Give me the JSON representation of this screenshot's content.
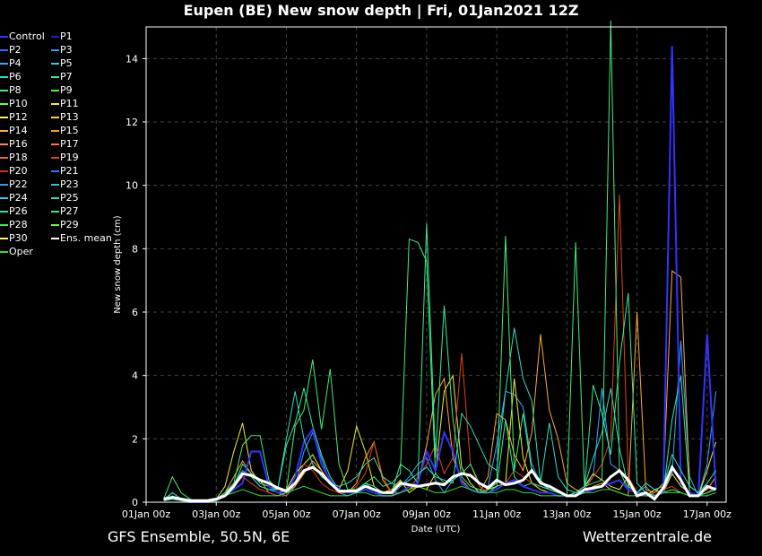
{
  "title": "Eupen  (BE)  New snow depth | Fri, 01Jan2021 12Z",
  "footer": {
    "left": "GFS Ensemble, 50.5N, 6E",
    "right": "Wetterzentrale.de"
  },
  "chart_data": {
    "type": "line",
    "xlabel": "Date (UTC)",
    "ylabel": "New snow depth (cm)",
    "ylim": [
      0,
      15
    ],
    "yticks": [
      0,
      2,
      4,
      6,
      8,
      10,
      12,
      14
    ],
    "xticks": [
      "01Jan 00z",
      "03Jan 00z",
      "05Jan 00z",
      "07Jan 00z",
      "09Jan 00z",
      "11Jan 00z",
      "13Jan 00z",
      "15Jan 00z",
      "17Jan 00z"
    ],
    "x_step_hours": 6,
    "x_start_hours": 12,
    "grid": true,
    "legend": [
      {
        "name": "Control",
        "color": "#3333ff"
      },
      {
        "name": "P1",
        "color": "#2222cc"
      },
      {
        "name": "P2",
        "color": "#3366ff"
      },
      {
        "name": "P3",
        "color": "#3399ff"
      },
      {
        "name": "P4",
        "color": "#33aaff"
      },
      {
        "name": "P5",
        "color": "#33ccdd"
      },
      {
        "name": "P6",
        "color": "#33ddcc"
      },
      {
        "name": "P7",
        "color": "#33ee99"
      },
      {
        "name": "P8",
        "color": "#44ee77"
      },
      {
        "name": "P9",
        "color": "#55ee44"
      },
      {
        "name": "P10",
        "color": "#66ff33"
      },
      {
        "name": "P11",
        "color": "#eeee33"
      },
      {
        "name": "P12",
        "color": "#ffee66"
      },
      {
        "name": "P13",
        "color": "#ffcc55"
      },
      {
        "name": "P14",
        "color": "#ffaa33"
      },
      {
        "name": "P15",
        "color": "#ff9922"
      },
      {
        "name": "P16",
        "color": "#ff8844"
      },
      {
        "name": "P17",
        "color": "#ff7733"
      },
      {
        "name": "P18",
        "color": "#ee6622"
      },
      {
        "name": "P19",
        "color": "#dd4411"
      },
      {
        "name": "P20",
        "color": "#cc3322"
      },
      {
        "name": "P21",
        "color": "#3377ee"
      },
      {
        "name": "P22",
        "color": "#3399ee"
      },
      {
        "name": "P23",
        "color": "#33bbee"
      },
      {
        "name": "P24",
        "color": "#33ccee"
      },
      {
        "name": "P25",
        "color": "#33ddbb"
      },
      {
        "name": "P26",
        "color": "#33dd99"
      },
      {
        "name": "P27",
        "color": "#33ee66"
      },
      {
        "name": "P28",
        "color": "#44ee55"
      },
      {
        "name": "P29",
        "color": "#66ff33"
      },
      {
        "name": "P30",
        "color": "#ffff55"
      },
      {
        "name": "Ens. mean",
        "color": "#ffffff"
      },
      {
        "name": "Oper",
        "color": "#33dd33"
      }
    ],
    "series": [
      {
        "name": "Ens. mean",
        "color": "#ffffff",
        "values": [
          0.1,
          0.15,
          0.1,
          0.05,
          0.05,
          0.05,
          0.1,
          0.2,
          0.5,
          0.9,
          0.85,
          0.7,
          0.6,
          0.45,
          0.35,
          0.6,
          1.0,
          1.1,
          0.9,
          0.6,
          0.35,
          0.35,
          0.35,
          0.5,
          0.4,
          0.3,
          0.3,
          0.6,
          0.55,
          0.5,
          0.55,
          0.6,
          0.55,
          0.8,
          0.9,
          0.85,
          0.6,
          0.45,
          0.7,
          0.55,
          0.6,
          0.7,
          1.0,
          0.6,
          0.5,
          0.35,
          0.2,
          0.2,
          0.4,
          0.45,
          0.5,
          0.8,
          1.0,
          0.7,
          0.2,
          0.3,
          0.1,
          0.45,
          1.1,
          0.7,
          0.2,
          0.2,
          0.5,
          0.4
        ]
      },
      {
        "name": "P22",
        "color": "#33aaff",
        "values": [
          0.1,
          0.3,
          0.1,
          0,
          0,
          0,
          0.1,
          0.2,
          0.6,
          1.0,
          0.8,
          0.5,
          0.4,
          0.3,
          0.2,
          0.5,
          1.6,
          2.2,
          1.4,
          0.6,
          0.3,
          0.2,
          0.3,
          0.6,
          0.4,
          0.2,
          0.2,
          0.5,
          0.8,
          1.2,
          1.4,
          0.7,
          0.3,
          0.7,
          0.9,
          0.8,
          0.6,
          0.5,
          1.8,
          3.5,
          3.4,
          3.0,
          1.2,
          0.6,
          0.4,
          0.3,
          0.2,
          0.3,
          0.5,
          0.8,
          3.6,
          1.2,
          1.0,
          0.7,
          0.3,
          0.5,
          0.2,
          0.4,
          0.9,
          5.1,
          0.8,
          0.2,
          1.2,
          3.5
        ]
      },
      {
        "name": "P11",
        "color": "#eeee33",
        "values": [
          0.05,
          0.1,
          0.05,
          0,
          0,
          0,
          0.1,
          0.5,
          1.6,
          2.5,
          1.0,
          0.6,
          0.5,
          0.3,
          0.4,
          0.9,
          1.2,
          1.5,
          1.0,
          0.6,
          0.4,
          1.0,
          2.4,
          1.6,
          0.5,
          0.3,
          0.4,
          0.7,
          0.3,
          0.5,
          0.4,
          0.9,
          3.5,
          4.0,
          1.1,
          0.6,
          0.3,
          0.4,
          0.5,
          0.6,
          3.9,
          1.4,
          0.6,
          0.4,
          0.3,
          0.2,
          0.2,
          0.3,
          0.5,
          0.9,
          0.7,
          0.5,
          0.4,
          0.8,
          0.3,
          0.2,
          0.4,
          0.3,
          0.9,
          0.5,
          0.3,
          0.2,
          1.0,
          1.9
        ]
      },
      {
        "name": "P14",
        "color": "#ffaa33",
        "values": [
          0.05,
          0.1,
          0.05,
          0,
          0,
          0,
          0.05,
          0.3,
          0.8,
          1.3,
          0.9,
          0.7,
          0.3,
          0.2,
          0.3,
          0.5,
          0.9,
          1.3,
          1.0,
          0.6,
          0.3,
          0.3,
          0.6,
          1.4,
          1.9,
          0.7,
          0.3,
          0.3,
          0.4,
          0.6,
          1.8,
          3.4,
          3.9,
          1.4,
          0.7,
          0.4,
          0.3,
          0.8,
          2.8,
          2.6,
          1.5,
          1.0,
          2.2,
          5.3,
          2.9,
          2.0,
          0.6,
          0.4,
          0.3,
          0.5,
          0.6,
          0.4,
          0.3,
          0.2,
          6.0,
          0.4,
          0.3,
          0.6,
          7.3,
          7.1,
          0.5,
          0.3,
          0.4,
          0.8
        ]
      },
      {
        "name": "P19",
        "color": "#dd4411",
        "values": [
          0.05,
          0.1,
          0.05,
          0,
          0,
          0,
          0.05,
          0.2,
          0.5,
          0.8,
          0.6,
          0.4,
          0.3,
          0.2,
          0.2,
          0.6,
          1.2,
          1.0,
          0.6,
          0.4,
          0.3,
          0.3,
          0.5,
          0.9,
          1.9,
          0.8,
          0.3,
          0.3,
          0.4,
          0.8,
          1.2,
          1.8,
          0.9,
          1.4,
          4.7,
          1.2,
          0.5,
          0.3,
          0.4,
          0.6,
          1.0,
          0.8,
          0.6,
          0.5,
          0.4,
          0.3,
          0.2,
          0.2,
          0.4,
          0.8,
          1.2,
          2.0,
          9.7,
          0.8,
          0.3,
          0.2,
          0.3,
          0.4,
          0.5,
          0.3,
          0.2,
          0.2,
          0.3,
          0.5
        ]
      },
      {
        "name": "P8",
        "color": "#44ee77",
        "values": [
          0.1,
          0.8,
          0.3,
          0.1,
          0,
          0,
          0.1,
          0.3,
          0.6,
          1.8,
          2.1,
          2.1,
          0.7,
          0.4,
          0.4,
          2.4,
          2.9,
          4.5,
          2.3,
          4.2,
          1.2,
          0.4,
          0.4,
          0.6,
          0.8,
          0.5,
          0.6,
          0.9,
          8.3,
          8.2,
          7.6,
          0.9,
          0.6,
          0.7,
          0.9,
          1.2,
          0.6,
          0.4,
          0.6,
          8.4,
          1.0,
          2.8,
          1.0,
          0.7,
          0.4,
          0.3,
          0.2,
          8.2,
          0.5,
          0.6,
          0.7,
          15.2,
          1.0,
          0.4,
          0.3,
          0.3,
          0.2,
          0.3,
          0.4,
          0.3,
          0.2,
          0.2,
          0.3,
          0.4
        ]
      },
      {
        "name": "P7",
        "color": "#33ee99",
        "values": [
          0.05,
          0.2,
          0.1,
          0,
          0,
          0,
          0.1,
          0.3,
          0.5,
          1.2,
          0.9,
          0.6,
          0.5,
          0.4,
          1.8,
          2.5,
          3.6,
          2.4,
          1.5,
          0.8,
          0.4,
          0.3,
          0.4,
          0.6,
          0.5,
          0.3,
          0.3,
          1.2,
          1.0,
          0.6,
          8.8,
          1.4,
          6.2,
          2.6,
          0.8,
          0.5,
          0.4,
          0.3,
          0.5,
          2.6,
          0.8,
          0.5,
          0.6,
          0.5,
          0.4,
          0.3,
          0.2,
          0.3,
          0.4,
          3.7,
          2.8,
          1.5,
          4.4,
          6.6,
          0.6,
          0.3,
          0.2,
          0.3,
          2.6,
          4.0,
          0.3,
          0.2,
          0.3,
          0.4
        ]
      },
      {
        "name": "Control",
        "color": "#3333ff",
        "values": [
          0.05,
          0.1,
          0.05,
          0,
          0,
          0,
          0.05,
          0.2,
          0.4,
          0.6,
          1.6,
          1.6,
          0.5,
          0.3,
          0.3,
          0.8,
          1.9,
          2.3,
          1.2,
          0.7,
          0.4,
          0.3,
          0.3,
          0.4,
          0.3,
          0.2,
          0.2,
          0.3,
          0.5,
          0.6,
          1.6,
          1.0,
          2.2,
          1.6,
          0.6,
          0.4,
          0.3,
          0.3,
          0.4,
          0.6,
          0.7,
          0.5,
          0.4,
          0.3,
          0.3,
          0.2,
          0.2,
          0.2,
          0.3,
          0.4,
          0.5,
          0.6,
          0.7,
          0.4,
          0.3,
          0.2,
          0.2,
          0.3,
          14.4,
          0.6,
          0.3,
          0.2,
          5.3,
          0.4
        ]
      },
      {
        "name": "P25",
        "color": "#33ddbb",
        "values": [
          0.05,
          0.3,
          0.1,
          0,
          0,
          0,
          0.1,
          0.2,
          0.5,
          0.9,
          0.8,
          0.5,
          0.4,
          0.4,
          2.0,
          3.5,
          2.0,
          1.2,
          0.8,
          0.6,
          0.5,
          0.6,
          0.8,
          1.2,
          1.4,
          0.8,
          0.6,
          0.5,
          0.7,
          0.9,
          1.1,
          0.8,
          0.7,
          0.6,
          2.8,
          2.4,
          1.8,
          1.2,
          1.0,
          3.5,
          5.5,
          3.9,
          3.2,
          0.6,
          2.5,
          0.8,
          0.4,
          0.3,
          0.5,
          1.4,
          2.2,
          3.6,
          1.7,
          0.5,
          0.3,
          0.6,
          0.4,
          0.5,
          1.5,
          1.0,
          0.5,
          0.3,
          0.6,
          1.0
        ]
      },
      {
        "name": "Oper",
        "color": "#33dd33",
        "values": [
          0.05,
          0.1,
          0.05,
          0,
          0,
          0,
          0.05,
          0.2,
          0.3,
          0.4,
          0.3,
          0.2,
          0.2,
          0.2,
          0.3,
          0.4,
          0.5,
          0.4,
          0.3,
          0.2,
          0.2,
          0.2,
          0.3,
          0.3,
          0.2,
          0.2,
          0.2,
          0.3,
          0.4,
          0.5,
          0.4,
          0.3,
          0.3,
          0.4,
          0.5,
          0.4,
          0.3,
          0.3,
          0.3,
          0.4,
          0.4,
          0.3,
          0.3,
          0.2,
          0.2,
          0.2,
          0.2,
          0.2,
          0.3,
          0.3,
          0.4,
          0.4,
          0.3,
          0.2,
          0.2,
          0.2,
          0.2,
          0.3,
          0.3,
          0.3,
          0.2,
          0.2,
          0.2,
          0.3
        ]
      }
    ]
  }
}
